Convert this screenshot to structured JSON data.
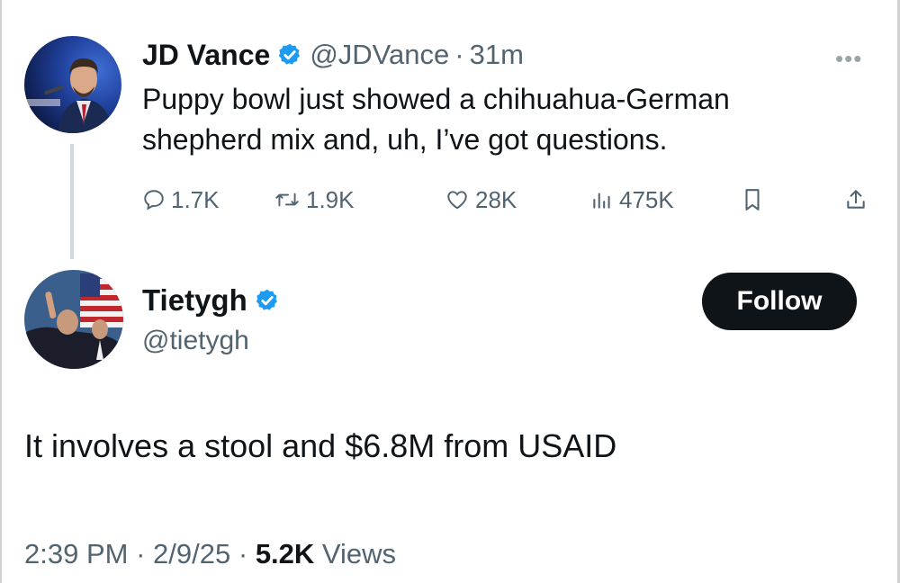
{
  "parent_tweet": {
    "author_name": "JD Vance",
    "handle": "@JDVance",
    "separator": "·",
    "time": "31m",
    "more_label": "•••",
    "text_line1": "Puppy bowl just showed a chihuahua-German",
    "text_line2": "shepherd mix and, uh, I’ve got questions.",
    "actions": {
      "replies": "1.7K",
      "reposts": "1.9K",
      "likes": "28K",
      "views": "475K"
    }
  },
  "reply_tweet": {
    "author_name": "Tietygh",
    "handle": "@tietygh",
    "follow_label": "Follow",
    "text": "It involves a stool and $6.8M from USAID",
    "timestamp_time": "2:39 PM",
    "timestamp_date": "2/9/25",
    "separator": "·",
    "views_count": "5.2K",
    "views_label": "Views"
  },
  "colors": {
    "verified_blue": "#1d9bf0",
    "text_primary": "#0f1419",
    "text_secondary": "#536471",
    "follow_bg": "#0f1419"
  },
  "icons": {
    "verified": "verified-badge-icon",
    "reply": "reply-icon",
    "repost": "repost-icon",
    "like": "heart-icon",
    "views": "views-chart-icon",
    "bookmark": "bookmark-icon",
    "share": "share-icon",
    "more": "more-icon"
  }
}
